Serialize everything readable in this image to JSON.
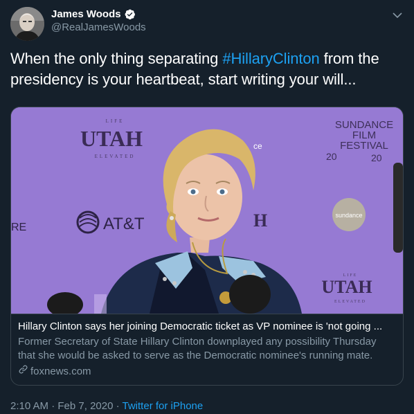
{
  "author": {
    "name": "James Woods",
    "handle": "@RealJamesWoods",
    "verified_icon": "verified-badge-icon"
  },
  "tweet": {
    "text_before": "When the only thing separating ",
    "hashtag": "#HillaryClinton",
    "text_after": " from the presidency is your heartbeat, start writing your will..."
  },
  "card": {
    "image_texts": {
      "life_top": "LIFE",
      "utah_top": "UTAH",
      "elevated_top": "ELEVATED",
      "att": "AT&T",
      "sundance_line1": "SUNDANCE",
      "sundance_line2": "FILM",
      "sundance_line3": "FESTIVAL",
      "sundance_year_left": "20",
      "sundance_year_right": "20",
      "sundance_circle": "sundance",
      "utah_bottom": "UTAH",
      "life_bottom": "LIFE",
      "elevated_bottom": "ELEVATED",
      "re_partial": "RE",
      "h_partial": "H",
      "ce_partial": "ce"
    },
    "title": "Hillary Clinton says her joining Democratic ticket as VP nominee is 'not going ...",
    "description": "Former Secretary of State Hillary Clinton downplayed any possibility Thursday that she would be asked to serve as the Democratic nominee's running mate.",
    "domain": "foxnews.com"
  },
  "meta": {
    "time": "2:10 AM",
    "separator1": " · ",
    "date": "Feb 7, 2020",
    "separator2": " · ",
    "source": "Twitter for iPhone"
  },
  "colors": {
    "background": "#15202b",
    "accent": "#1da1f2",
    "secondary_text": "#8899a6",
    "border": "#38444d",
    "backdrop": "#9a7ed6"
  }
}
